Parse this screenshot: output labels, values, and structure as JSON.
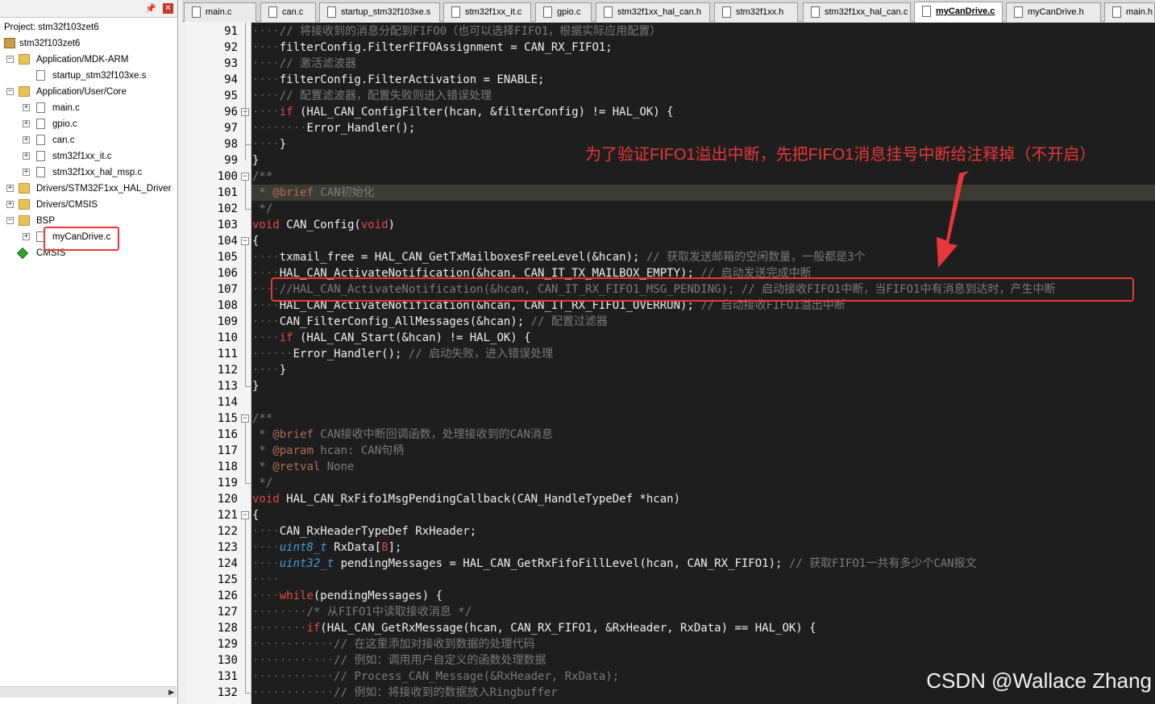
{
  "project": {
    "title": "Project: stm32f103zet6",
    "nodes": [
      {
        "label": "stm32f103zet6",
        "level": 0,
        "icon": "project-icon",
        "exp": ""
      },
      {
        "label": "Application/MDK-ARM",
        "level": 1,
        "icon": "folder-icon",
        "exp": "−"
      },
      {
        "label": "startup_stm32f103xe.s",
        "level": 2,
        "icon": "file-icon",
        "exp": ""
      },
      {
        "label": "Application/User/Core",
        "level": 1,
        "icon": "folder-icon",
        "exp": "−"
      },
      {
        "label": "main.c",
        "level": 2,
        "icon": "file-icon",
        "exp": "+"
      },
      {
        "label": "gpio.c",
        "level": 2,
        "icon": "file-icon",
        "exp": "+"
      },
      {
        "label": "can.c",
        "level": 2,
        "icon": "file-icon",
        "exp": "+"
      },
      {
        "label": "stm32f1xx_it.c",
        "level": 2,
        "icon": "file-icon",
        "exp": "+"
      },
      {
        "label": "stm32f1xx_hal_msp.c",
        "level": 2,
        "icon": "file-icon",
        "exp": "+"
      },
      {
        "label": "Drivers/STM32F1xx_HAL_Driver",
        "level": 1,
        "icon": "folder-icon",
        "exp": "+"
      },
      {
        "label": "Drivers/CMSIS",
        "level": 1,
        "icon": "folder-icon",
        "exp": "+"
      },
      {
        "label": "BSP",
        "level": 1,
        "icon": "folder-icon",
        "exp": "−"
      },
      {
        "label": "myCanDrive.c",
        "level": 2,
        "icon": "file-icon",
        "exp": "+"
      },
      {
        "label": "CMSIS",
        "level": 1,
        "icon": "diamond-icon",
        "exp": ""
      }
    ]
  },
  "tabs": [
    {
      "label": "main.c",
      "active": false
    },
    {
      "label": "can.c",
      "active": false
    },
    {
      "label": "startup_stm32f103xe.s",
      "active": false
    },
    {
      "label": "stm32f1xx_it.c",
      "active": false
    },
    {
      "label": "gpio.c",
      "active": false
    },
    {
      "label": "stm32f1xx_hal_can.h",
      "active": false
    },
    {
      "label": "stm32f1xx.h",
      "active": false
    },
    {
      "label": "stm32f1xx_hal_can.c",
      "active": false
    },
    {
      "label": "myCanDrive.c",
      "active": true
    },
    {
      "label": "myCanDrive.h",
      "active": false
    },
    {
      "label": "main.h",
      "active": false
    }
  ],
  "code": [
    {
      "n": "91",
      "ind": 4,
      "t": [
        [
          "cmt",
          "// 将接收到的消息分配到FIFO0（也可以选择FIFO1，根据实际应用配置）"
        ]
      ]
    },
    {
      "n": "92",
      "ind": 4,
      "t": [
        [
          "",
          "filterConfig.FilterFIFOAssignment = CAN_RX_FIFO1;"
        ]
      ]
    },
    {
      "n": "93",
      "ind": 4,
      "t": [
        [
          "cmt",
          "// 激活滤波器"
        ]
      ]
    },
    {
      "n": "94",
      "ind": 4,
      "t": [
        [
          "",
          "filterConfig.FilterActivation = ENABLE;"
        ]
      ]
    },
    {
      "n": "95",
      "ind": 4,
      "t": [
        [
          "cmt",
          "// 配置滤波器，配置失败则进入错误处理"
        ]
      ]
    },
    {
      "n": "96",
      "ind": 4,
      "t": [
        [
          "kw",
          "if"
        ],
        [
          "",
          " (HAL_CAN_ConfigFilter(hcan, &filterConfig) != HAL_OK) {"
        ]
      ]
    },
    {
      "n": "97",
      "ind": 8,
      "t": [
        [
          "",
          "Error_Handler();"
        ]
      ]
    },
    {
      "n": "98",
      "ind": 4,
      "t": [
        [
          "",
          "}"
        ]
      ]
    },
    {
      "n": "99",
      "ind": 0,
      "t": [
        [
          "",
          "}"
        ]
      ]
    },
    {
      "n": "100",
      "ind": 0,
      "t": [
        [
          "cmt",
          "/**"
        ]
      ]
    },
    {
      "n": "101",
      "ind": 0,
      "hl": true,
      "t": [
        [
          "cmt",
          " * "
        ],
        [
          "tag",
          "@brief"
        ],
        [
          "cmt",
          " CAN初始化"
        ]
      ]
    },
    {
      "n": "102",
      "ind": 0,
      "t": [
        [
          "cmt",
          " */"
        ]
      ]
    },
    {
      "n": "103",
      "ind": 0,
      "t": [
        [
          "kw",
          "void"
        ],
        [
          "",
          " CAN_Config("
        ],
        [
          "kw",
          "void"
        ],
        [
          "",
          ")"
        ]
      ]
    },
    {
      "n": "104",
      "ind": 0,
      "t": [
        [
          "",
          "{"
        ]
      ]
    },
    {
      "n": "105",
      "ind": 4,
      "t": [
        [
          "",
          "txmail_free = HAL_CAN_GetTxMailboxesFreeLevel(&hcan); "
        ],
        [
          "cmt",
          "// 获取发送邮箱的空闲数量，一般都是3个"
        ]
      ]
    },
    {
      "n": "106",
      "ind": 4,
      "t": [
        [
          "",
          "HAL_CAN_ActivateNotification(&hcan, CAN_IT_TX_MAILBOX_EMPTY); "
        ],
        [
          "cmt",
          "// 启动发送完成中断"
        ]
      ]
    },
    {
      "n": "107",
      "ind": 4,
      "t": [
        [
          "cmt",
          "//HAL_CAN_ActivateNotification(&hcan, CAN_IT_RX_FIFO1_MSG_PENDING); // 启动接收FIFO1中断，当FIFO1中有消息到达时，产生中断"
        ]
      ]
    },
    {
      "n": "108",
      "ind": 4,
      "t": [
        [
          "",
          "HAL_CAN_ActivateNotification(&hcan, CAN_IT_RX_FIFO1_OVERRUN); "
        ],
        [
          "cmt",
          "// 启动接收FIFO1溢出中断"
        ]
      ]
    },
    {
      "n": "109",
      "ind": 4,
      "t": [
        [
          "",
          "CAN_FilterConfig_AllMessages(&hcan); "
        ],
        [
          "cmt",
          "// 配置过滤器"
        ]
      ]
    },
    {
      "n": "110",
      "ind": 4,
      "t": [
        [
          "kw",
          "if"
        ],
        [
          "",
          " (HAL_CAN_Start(&hcan) != HAL_OK) {"
        ]
      ]
    },
    {
      "n": "111",
      "ind": 6,
      "t": [
        [
          "",
          "Error_Handler(); "
        ],
        [
          "cmt",
          "// 启动失败，进入错误处理"
        ]
      ]
    },
    {
      "n": "112",
      "ind": 4,
      "t": [
        [
          "",
          "}"
        ]
      ]
    },
    {
      "n": "113",
      "ind": 0,
      "t": [
        [
          "",
          "}"
        ]
      ]
    },
    {
      "n": "114",
      "ind": 0,
      "t": []
    },
    {
      "n": "115",
      "ind": 0,
      "t": [
        [
          "cmt",
          "/**"
        ]
      ]
    },
    {
      "n": "116",
      "ind": 0,
      "t": [
        [
          "cmt",
          " * "
        ],
        [
          "tag",
          "@brief"
        ],
        [
          "cmt",
          " CAN接收中断回调函数，处理接收到的CAN消息"
        ]
      ]
    },
    {
      "n": "117",
      "ind": 0,
      "t": [
        [
          "cmt",
          " * "
        ],
        [
          "tag",
          "@param"
        ],
        [
          "cmt",
          " hcan: CAN句柄"
        ]
      ]
    },
    {
      "n": "118",
      "ind": 0,
      "t": [
        [
          "cmt",
          " * "
        ],
        [
          "tag",
          "@retval"
        ],
        [
          "cmt",
          " None"
        ]
      ]
    },
    {
      "n": "119",
      "ind": 0,
      "t": [
        [
          "cmt",
          " */"
        ]
      ]
    },
    {
      "n": "120",
      "ind": 0,
      "t": [
        [
          "kw",
          "void"
        ],
        [
          "",
          " HAL_CAN_RxFifo1MsgPendingCallback(CAN_HandleTypeDef *hcan)"
        ]
      ]
    },
    {
      "n": "121",
      "ind": 0,
      "t": [
        [
          "",
          "{"
        ]
      ]
    },
    {
      "n": "122",
      "ind": 4,
      "t": [
        [
          "",
          "CAN_RxHeaderTypeDef RxHeader;"
        ]
      ]
    },
    {
      "n": "123",
      "ind": 4,
      "t": [
        [
          "ty",
          "uint8_t"
        ],
        [
          "",
          " RxData["
        ],
        [
          "num",
          "8"
        ],
        [
          "",
          "];"
        ]
      ]
    },
    {
      "n": "124",
      "ind": 4,
      "t": [
        [
          "ty",
          "uint32_t"
        ],
        [
          "",
          " pendingMessages = HAL_CAN_GetRxFifoFillLevel(hcan, CAN_RX_FIFO1); "
        ],
        [
          "cmt",
          "// 获取FIFO1一共有多少个CAN报文"
        ]
      ]
    },
    {
      "n": "125",
      "ind": 4,
      "t": []
    },
    {
      "n": "126",
      "ind": 4,
      "t": [
        [
          "kw",
          "while"
        ],
        [
          "",
          "(pendingMessages) {"
        ]
      ]
    },
    {
      "n": "127",
      "ind": 8,
      "t": [
        [
          "cmt",
          "/* 从FIFO1中读取接收消息 */"
        ]
      ]
    },
    {
      "n": "128",
      "ind": 8,
      "t": [
        [
          "kw",
          "if"
        ],
        [
          "",
          "(HAL_CAN_GetRxMessage(hcan, CAN_RX_FIFO1, &RxHeader, RxData) == HAL_OK) {"
        ]
      ]
    },
    {
      "n": "129",
      "ind": 12,
      "t": [
        [
          "cmt",
          "// 在这里添加对接收到数据的处理代码"
        ]
      ]
    },
    {
      "n": "130",
      "ind": 12,
      "t": [
        [
          "cmt",
          "// 例如：调用用户自定义的函数处理数据"
        ]
      ]
    },
    {
      "n": "131",
      "ind": 12,
      "t": [
        [
          "cmt",
          "// Process_CAN_Message(&RxHeader, RxData);"
        ]
      ]
    },
    {
      "n": "132",
      "ind": 12,
      "t": [
        [
          "cmt",
          "// 例如：将接收到的数据放入Ringbuffer"
        ]
      ]
    }
  ],
  "annotation": "为了验证FIFO1溢出中断，先把FIFO1消息挂号中断给注释掉（不开启）",
  "watermark": "CSDN @Wallace Zhang",
  "colors": {
    "annotation_red": "#e8373a",
    "editor_bg": "#1e1e1e",
    "keyword": "#e04a4a",
    "type": "#4a9be0",
    "comment": "#7b7b7b"
  }
}
